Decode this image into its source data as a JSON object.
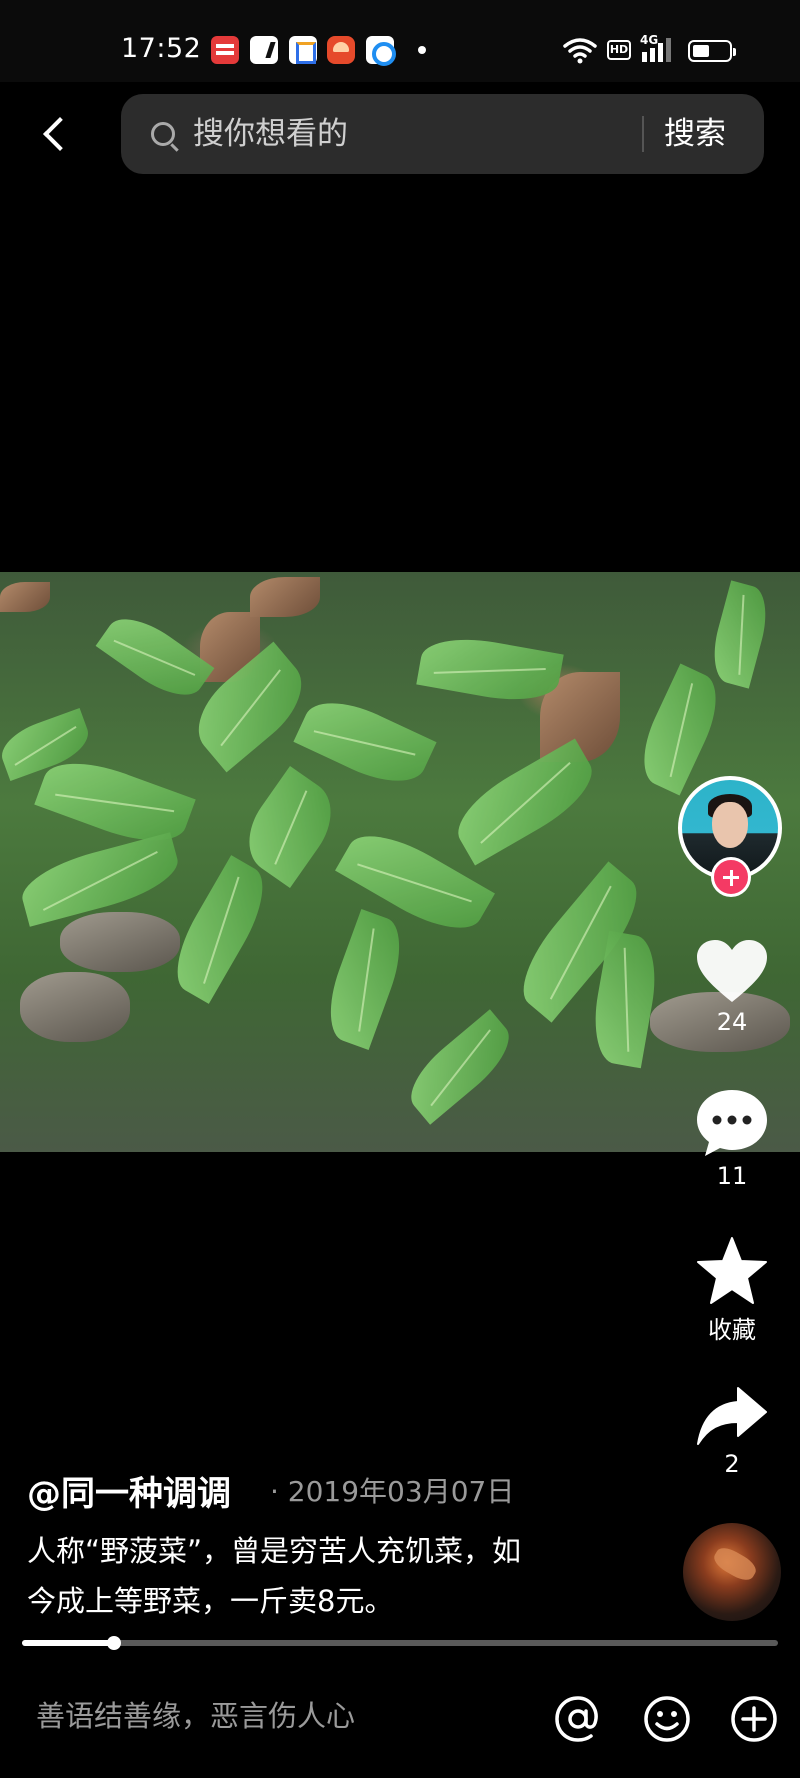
{
  "status_bar": {
    "time": "17:52",
    "notification_icons": [
      "toutiao-app-icon",
      "maps-app-icon",
      "job-app-icon",
      "video-app-icon",
      "browser-app-icon"
    ],
    "network_badge": "HD",
    "network_type": "4G"
  },
  "search": {
    "placeholder": "搜你想看的",
    "button_label": "搜索"
  },
  "video": {
    "progress_fraction": 0.122
  },
  "actions": {
    "like_count": "24",
    "comment_count": "11",
    "favorite_label": "收藏",
    "share_count": "2"
  },
  "post": {
    "author": "@同一种调调",
    "date": "· 2019年03月07日",
    "caption_line1": "人称“野菠菜”，曾是穷苦人充饥菜，如",
    "caption_line2": "今成上等野菜，一斤卖8元。"
  },
  "comment_bar": {
    "placeholder": "善语结善缘，恶言伤人心"
  },
  "colors": {
    "background": "#000000",
    "search_box": "#2c2c2c",
    "follow_accent": "#f43a64",
    "secondary_text": "#9a9a9a"
  }
}
